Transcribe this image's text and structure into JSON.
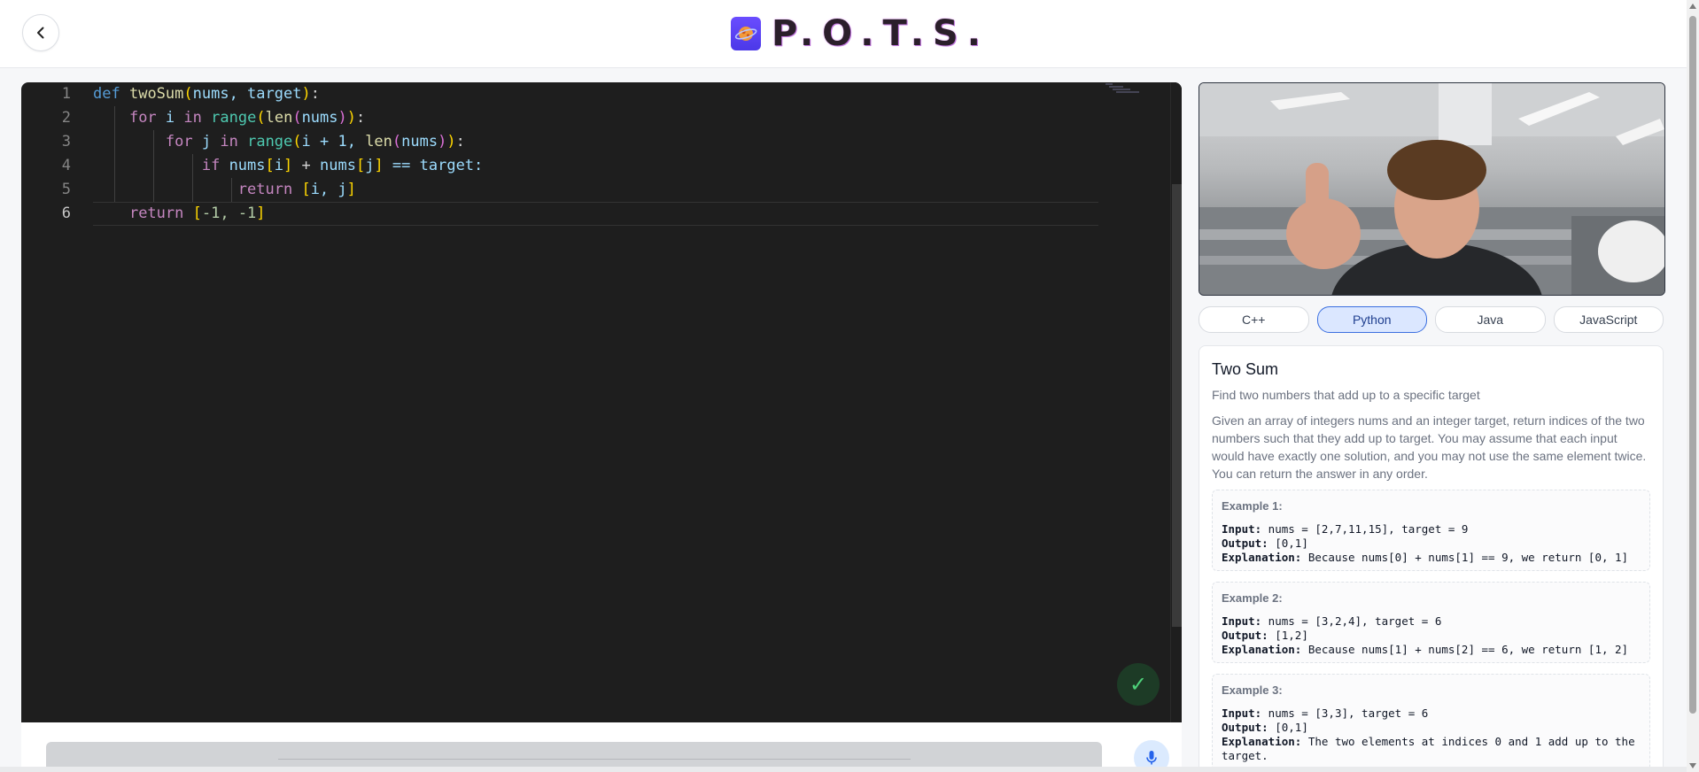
{
  "header": {
    "title": "P.O.T.S.",
    "back_icon": "chevron-left-icon",
    "logo_icon": "planet-icon"
  },
  "editor": {
    "language": "Python",
    "lines": [
      {
        "no": "1"
      },
      {
        "no": "2"
      },
      {
        "no": "3"
      },
      {
        "no": "4"
      },
      {
        "no": "5"
      },
      {
        "no": "6"
      }
    ],
    "code": {
      "l1": {
        "def": "def",
        "name": "twoSum",
        "args": "nums, target",
        "end": ":"
      },
      "l2": {
        "for": "for",
        "var": "i",
        "in": "in",
        "range": "range",
        "len": "len",
        "arg": "nums",
        "end": ":"
      },
      "l3": {
        "for": "for",
        "var": "j",
        "in": "in",
        "range": "range",
        "start": "i + 1, ",
        "len": "len",
        "arg": "nums",
        "end": ":"
      },
      "l4": {
        "if": "if",
        "expr1": "nums",
        "i": "i",
        "plus": " + ",
        "expr2": "nums",
        "j": "j",
        "rest": " == target:"
      },
      "l5": {
        "ret": "return",
        "val": "i, j"
      },
      "l6": {
        "ret": "return",
        "val": "-1, -1"
      }
    },
    "run_status_icon": "check-icon",
    "run_status_glyph": "✓"
  },
  "input": {
    "placeholder": "",
    "mic_icon": "microphone-icon"
  },
  "languages": [
    {
      "label": "C++",
      "active": false
    },
    {
      "label": "Python",
      "active": true
    },
    {
      "label": "Java",
      "active": false
    },
    {
      "label": "JavaScript",
      "active": false
    }
  ],
  "problem": {
    "title": "Two Sum",
    "subtitle": "Find two numbers that add up to a specific target",
    "description": "Given an array of integers nums and an integer target, return indices of the two numbers such that they add up to target. You may assume that each input would have exactly one solution, and you may not use the same element twice. You can return the answer in any order.",
    "examples": [
      {
        "title": "Example 1:",
        "input_label": "Input:",
        "input": " nums = [2,7,11,15], target = 9",
        "output_label": "Output:",
        "output": " [0,1]",
        "explanation_label": "Explanation:",
        "explanation": " Because nums[0] + nums[1] == 9, we return [0, 1]"
      },
      {
        "title": "Example 2:",
        "input_label": "Input:",
        "input": " nums = [3,2,4], target = 6",
        "output_label": "Output:",
        "output": " [1,2]",
        "explanation_label": "Explanation:",
        "explanation": " Because nums[1] + nums[2] == 6, we return [1, 2]"
      },
      {
        "title": "Example 3:",
        "input_label": "Input:",
        "input": " nums = [3,3], target = 6",
        "output_label": "Output:",
        "output": " [0,1]",
        "explanation_label": "Explanation:",
        "explanation": " The two elements at indices 0 and 1 add up to the target."
      }
    ]
  },
  "colors": {
    "editor_bg": "#1e1e1e",
    "accent": "#3b6fe0",
    "brand": "#4b38e8",
    "success": "#4ed27a"
  }
}
